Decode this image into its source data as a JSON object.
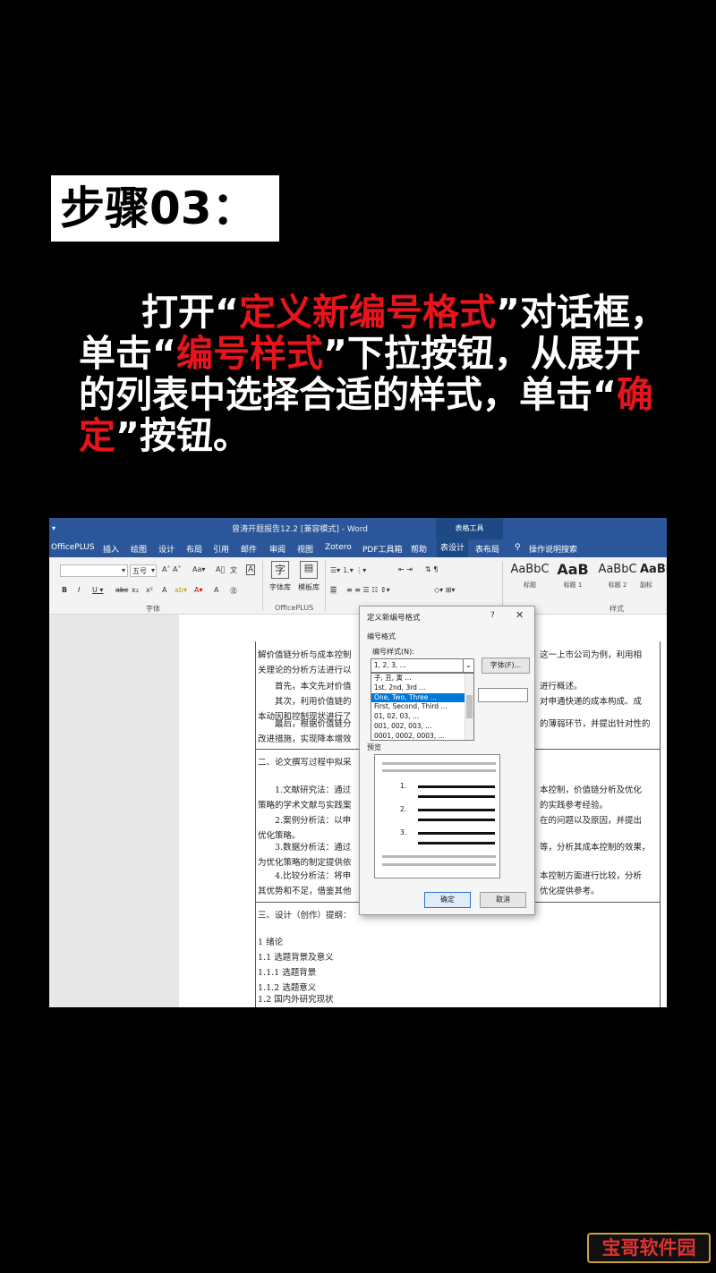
{
  "step_label": "步骤03：",
  "instruction": {
    "p1": "打开“",
    "hl1": "定义新编号格式",
    "p2": "”对话框，单击“",
    "hl2": "编号样式",
    "p3": "”下拉按钮，从展开的列表中选择合适的样式，单击“",
    "hl3": "确定",
    "p4": "”按钮。"
  },
  "word": {
    "title": "曾涛开题报告12.2 [兼容模式] - Word",
    "table_tools": "表格工具",
    "menu": [
      "OfficePLUS",
      "插入",
      "绘图",
      "设计",
      "布局",
      "引用",
      "邮件",
      "审阅",
      "视图",
      "Zotero",
      "PDF工具箱",
      "帮助",
      "表设计",
      "表布局",
      "操作说明搜索"
    ],
    "ribbon": {
      "font_size": "五号",
      "font_group": "字体",
      "officeplus_group": "OfficePLUS",
      "style_group": "样式",
      "char_lib": "字体库",
      "template_lib": "模板库",
      "styles": [
        {
          "sample": "AaBbC",
          "name": "标题"
        },
        {
          "sample": "AaB",
          "name": "标题 1"
        },
        {
          "sample": "AaBbC",
          "name": "标题 2"
        },
        {
          "sample": "AaBl",
          "name": "副标"
        }
      ]
    },
    "doc_lines": [
      "解价值链分析与成本控制",
      "关理论的分析方法进行以",
      "首先，本文先对价值",
      "其次，利用价值链的",
      "本动因和控制现状进行了",
      "最后，根据价值链分",
      "改进措施，实现降本增效",
      "二、论文撰写过程中拟采",
      "1.文献研究法：通过",
      "策略的学术文献与实践案",
      "2.案例分析法：以申",
      "优化策略。",
      "3.数据分析法：通过",
      "为优化策略的制定提供依",
      "4.比较分析法：将申",
      "其优势和不足，借鉴其他",
      "三、设计（创作）提纲：",
      "1   绪论",
      "1.1   选题背景及意义",
      "1.1.1   选题背景",
      "1.1.2   选题意义",
      "1.2   国内外研究现状"
    ],
    "doc_right_lines": [
      "这一上市公司为例，利用相",
      "进行概述。",
      "对申通快递的成本构成、成",
      "的薄弱环节，并提出针对性的",
      "本控制，价值链分析及优化",
      "的实践参考经验。",
      "在的问题以及原因，并提出",
      "等，分析其成本控制的效果，",
      "本控制方面进行比较，分析",
      "优化提供参考。"
    ]
  },
  "dialog": {
    "title": "定义新编号格式",
    "help": "?",
    "close": "✕",
    "section_label": "编号格式",
    "style_label": "编号样式(N):",
    "selected_value": "1, 2, 3, ...",
    "font_button": "字体(F)...",
    "options": [
      "子, 丑, 寅 ...",
      "1st, 2nd, 3rd ...",
      "One, Two, Three ...",
      "First, Second, Third ...",
      "01, 02, 03, ...",
      "001, 002, 003, ...",
      "0001, 0002, 0003, ..."
    ],
    "selected_option_index": 2,
    "preview_label": "预览",
    "preview_numbers": [
      "1.",
      "2.",
      "3."
    ],
    "ok_button": "确定",
    "cancel_button": "取消"
  },
  "watermark": "宝哥软件园"
}
